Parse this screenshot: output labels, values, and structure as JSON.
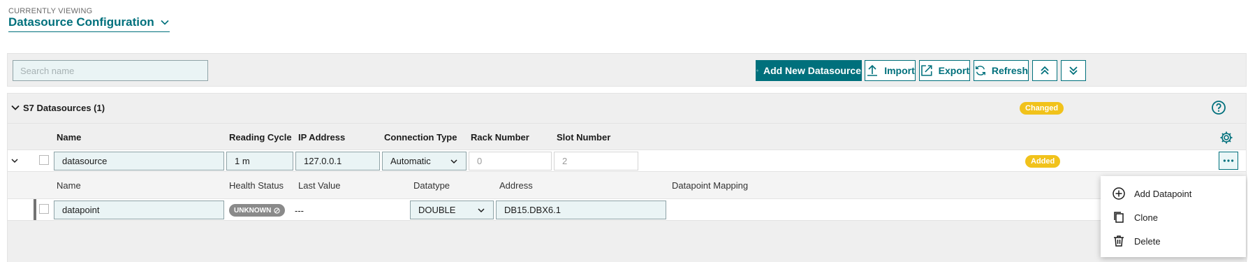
{
  "header": {
    "viewing_label": "CURRENTLY VIEWING",
    "title": "Datasource Configuration"
  },
  "toolbar": {
    "search_placeholder": "Search name",
    "add_new": "Add New Datasource",
    "import": "Import",
    "export": "Export",
    "refresh": "Refresh"
  },
  "section": {
    "title": "S7 Datasources (1)",
    "status_badge": "Changed"
  },
  "datasource_columns": [
    "Name",
    "Reading Cycle",
    "IP Address",
    "Connection Type",
    "Rack Number",
    "Slot Number"
  ],
  "datasource": {
    "name": "datasource",
    "reading_cycle": "1 m",
    "ip_address": "127.0.0.1",
    "connection_type": "Automatic",
    "rack_number": "0",
    "slot_number": "2",
    "status_badge": "Added"
  },
  "datapoint_columns": [
    "Name",
    "Health Status",
    "Last Value",
    "Datatype",
    "Address",
    "Datapoint Mapping"
  ],
  "datapoint": {
    "name": "datapoint",
    "health_status": "UNKNOWN",
    "last_value": "---",
    "datatype": "DOUBLE",
    "address": "DB15.DBX6.1"
  },
  "menu": {
    "items": [
      "Add Datapoint",
      "Clone",
      "Delete"
    ]
  },
  "colors": {
    "accent": "#00707c",
    "badge": "#f1c21b",
    "health_unknown": "#8a8a8a"
  }
}
